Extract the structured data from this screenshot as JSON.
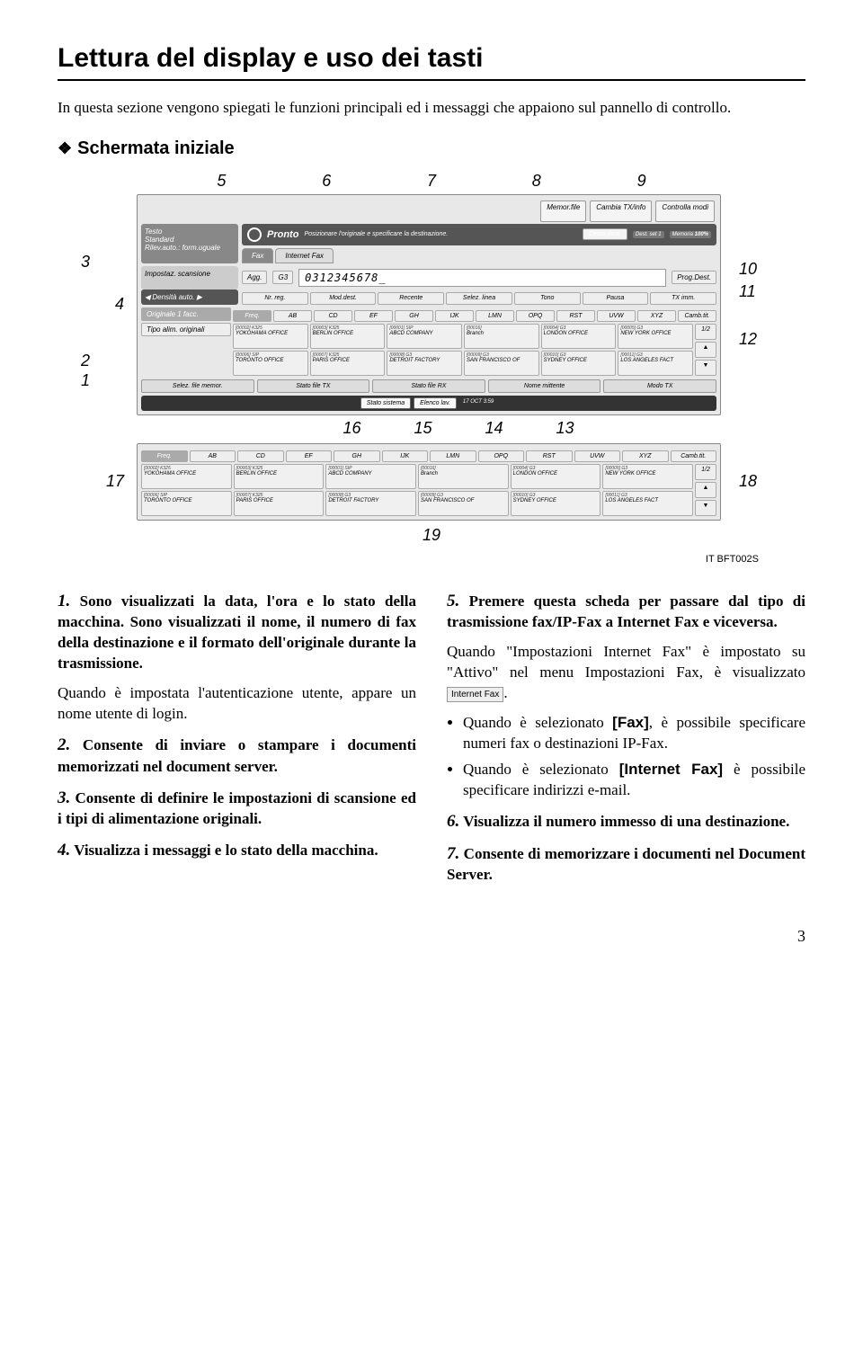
{
  "page": {
    "title": "Lettura del display e uso dei tasti",
    "intro": "In questa sezione vengono spiegati le funzioni principali ed i messaggi che appaiono sul pannello di controllo.",
    "section_heading": "Schermata iniziale",
    "number": "3"
  },
  "callouts": {
    "top": [
      "5",
      "6",
      "7",
      "8",
      "9"
    ],
    "left": [
      "4",
      "3",
      "2",
      "1"
    ],
    "right": [
      "10",
      "11",
      "12"
    ],
    "under": [
      "16",
      "15",
      "14",
      "13"
    ],
    "side17": "17",
    "side18": "18",
    "side19": "19"
  },
  "figure_code": "IT BFT002S",
  "panel": {
    "top_buttons": [
      "Memor.file",
      "Cambia TX/info",
      "Controlla modi"
    ],
    "status": "Pronto",
    "status_sub": "Posizionare l'originale e specificare la destinazione.",
    "search_label": "Cerca dest.",
    "dest_set": "Dest. set",
    "memoria": "Memoria",
    "memoria_pct": "100%",
    "left_labels": [
      "Testo",
      "Standard",
      "Rilev.auto.: form.uguale",
      "Impostaz. scansione",
      "Densità auto.",
      "Originale 1 facc.",
      "Tipo alim. originali"
    ],
    "tabs": [
      "Fax",
      "Internet Fax"
    ],
    "agg": "Agg.",
    "g3": "G3",
    "dial": "0312345678_",
    "prog_dest": "Prog.Dest.",
    "key_row1": [
      "Nr. reg.",
      "Mod.dest.",
      "Recente",
      "Selez. linea",
      "",
      "Tono",
      "Pausa",
      "",
      "TX imm."
    ],
    "freq": "Freq.",
    "alpha_keys": [
      "AB",
      "CD",
      "EF",
      "GH",
      "IJK",
      "LMN",
      "OPQ",
      "RST",
      "UVW",
      "XYZ",
      "Camb.tit."
    ],
    "addresses_top": [
      {
        "code": "[00002] K325",
        "name": "YOKOHAMA OFFICE"
      },
      {
        "code": "[00003] K325",
        "name": "BERLIN OFFICE"
      },
      {
        "code": "[00001] SIP",
        "name": "ABCD COMPANY"
      },
      {
        "code": "[00016]",
        "name": "Branch"
      },
      {
        "code": "[00004] G3",
        "name": "LONDON OFFICE"
      },
      {
        "code": "[00005] G3",
        "name": "NEW YORK OFFICE"
      }
    ],
    "addresses_bot": [
      {
        "code": "[00006] SIP",
        "name": "TORONTO OFFICE"
      },
      {
        "code": "[00007] K325",
        "name": "PARIS OFFICE"
      },
      {
        "code": "[00008] G3",
        "name": "DETROIT FACTORY"
      },
      {
        "code": "[00009] G3",
        "name": "SAN FRANCISCO OF"
      },
      {
        "code": "[00010] G3",
        "name": "SYDNEY OFFICE"
      },
      {
        "code": "[00011] G3",
        "name": "LOS ANGELES FACT"
      }
    ],
    "page_ind": "1/2",
    "bottom_row": [
      "Selez. file memor.",
      "Stato file TX",
      "Stato file RX",
      "Nome mittente",
      "Modo TX"
    ],
    "black_bar": [
      "Stato sistema",
      "Elenco lav."
    ],
    "datetime": "17 OCT 3:59"
  },
  "body": {
    "p1_lead": "1.",
    "p1_bold": " Sono visualizzati la data, l'ora e lo stato della macchina. Sono visualizzati il nome, il numero di fax della destinazione e il formato dell'originale durante la trasmissione.",
    "p1_extra": "Quando è impostata l'autenticazione utente, appare un nome utente di login.",
    "p2_lead": "2.",
    "p2": " Consente di inviare o stampare i documenti memorizzati nel document server.",
    "p3_lead": "3.",
    "p3": " Consente di definire le impostazioni di scansione ed i tipi di alimentazione originali.",
    "p4_lead": "4.",
    "p4": " Visualizza i messaggi e lo stato della macchina.",
    "p5_lead": "5.",
    "p5_bold": " Premere questa scheda per passare dal tipo di trasmissione fax/IP-Fax a Internet Fax e viceversa.",
    "p5_extra_a": "Quando \"Impostazioni Internet Fax\" è impostato su \"Attivo\" nel menu Impostazioni Fax, è visualizzato ",
    "p5_btn": "Internet Fax",
    "p5_extra_b": ".",
    "p5_li1_a": "Quando è selezionato ",
    "p5_li1_btn": "[Fax]",
    "p5_li1_b": ", è possibile specificare numeri fax o destinazioni IP-Fax.",
    "p5_li2_a": "Quando è selezionato ",
    "p5_li2_btn": "[Internet Fax]",
    "p5_li2_b": " è possibile specificare indirizzi e-mail.",
    "p6_lead": "6.",
    "p6": " Visualizza il numero immesso di una destinazione.",
    "p7_lead": "7.",
    "p7": " Consente di memorizzare i documenti nel Document Server."
  }
}
